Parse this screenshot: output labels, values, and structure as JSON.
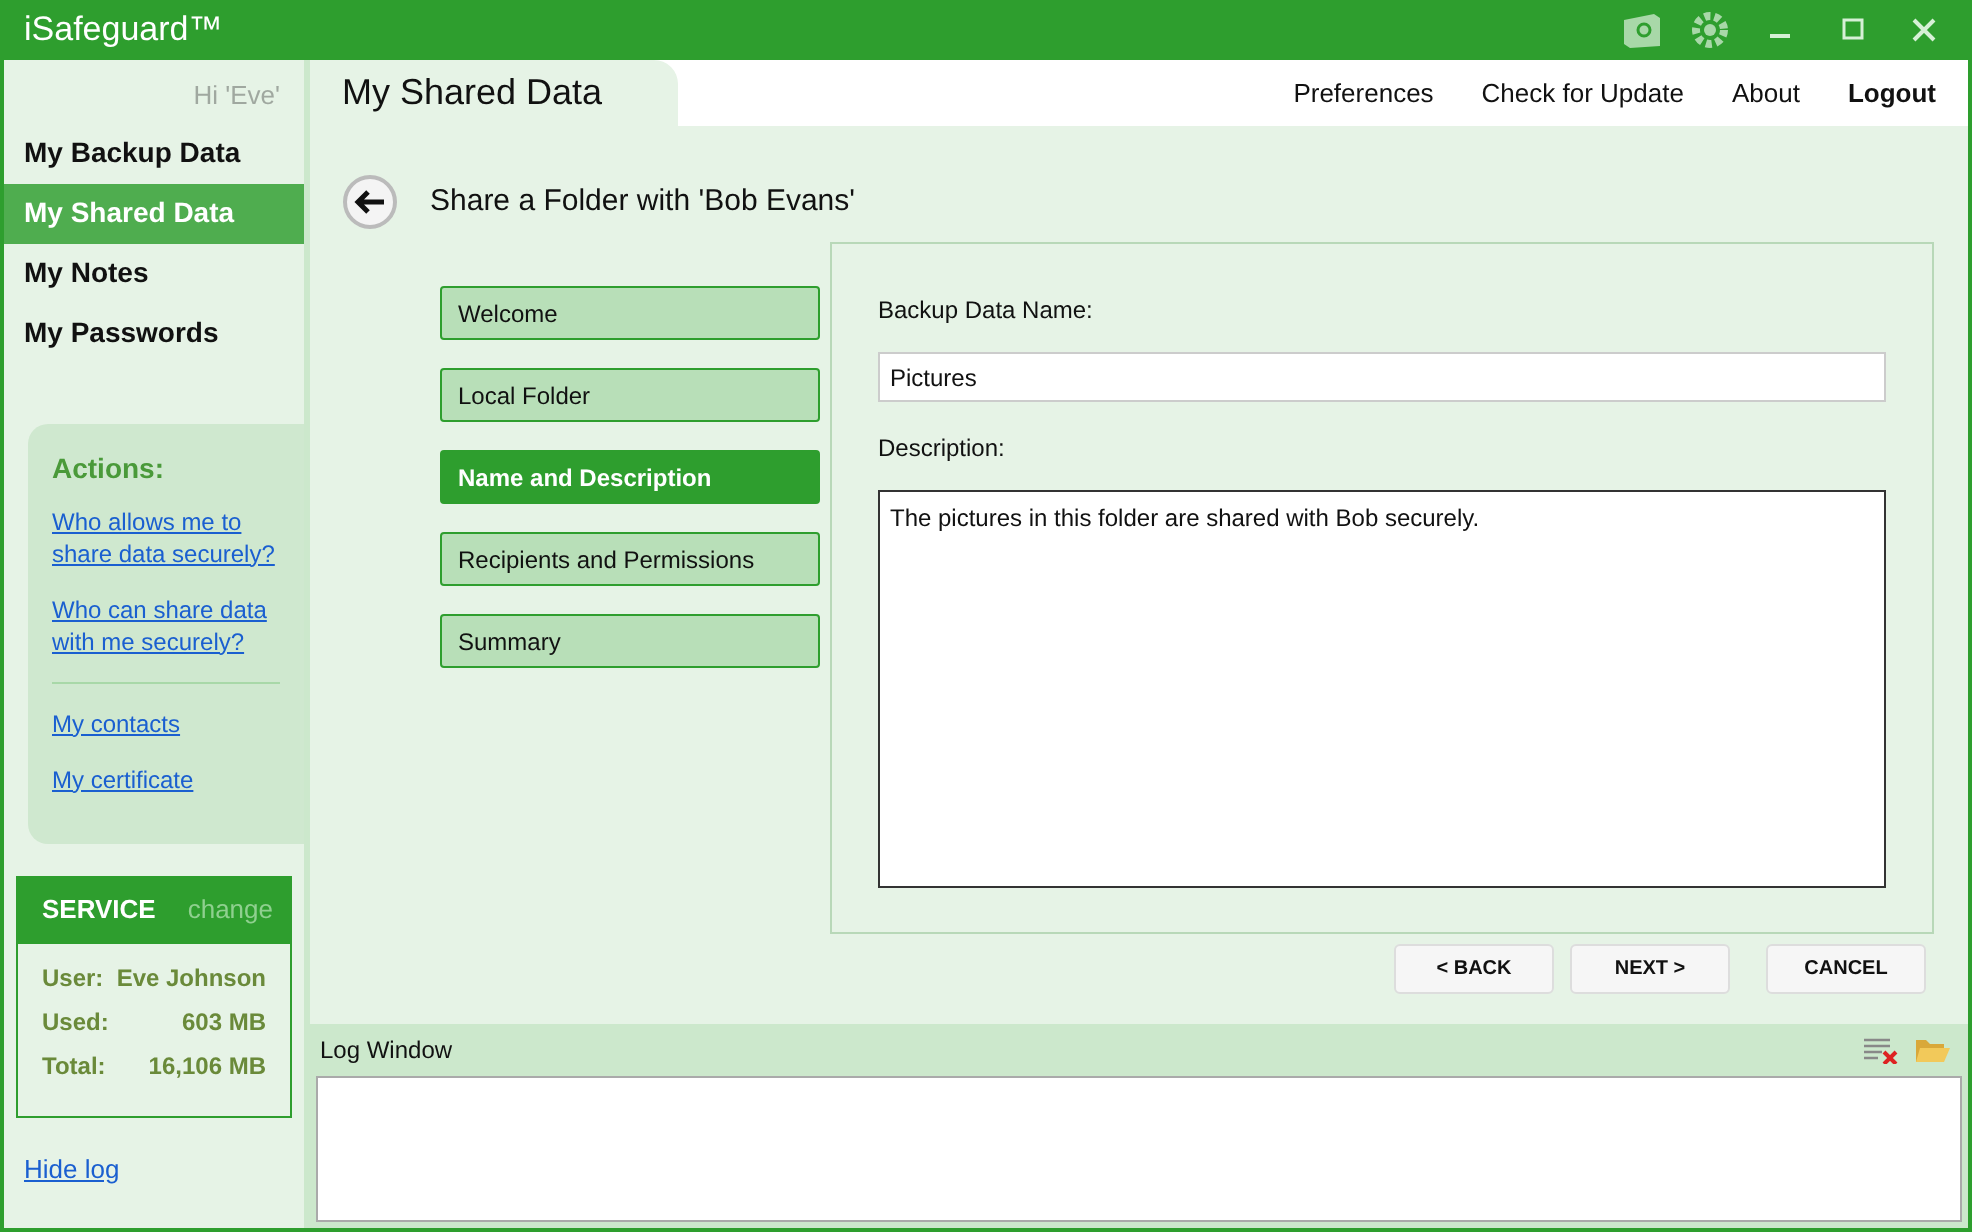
{
  "window": {
    "title": "iSafeguard™"
  },
  "greeting": "Hi 'Eve'",
  "nav": [
    {
      "label": "My Backup Data",
      "selected": false
    },
    {
      "label": "My Shared Data",
      "selected": true
    },
    {
      "label": "My Notes",
      "selected": false
    },
    {
      "label": "My Passwords",
      "selected": false
    }
  ],
  "actions": {
    "title": "Actions:",
    "links": [
      "Who allows me to share data securely?",
      "Who can share data with me securely?"
    ],
    "more_links": [
      "My contacts",
      "My certificate"
    ]
  },
  "service": {
    "title": "SERVICE",
    "change": "change",
    "rows": [
      {
        "label": "User:",
        "value": "Eve Johnson"
      },
      {
        "label": "Used:",
        "value": "603 MB"
      },
      {
        "label": "Total:",
        "value": "16,106 MB"
      }
    ]
  },
  "hide_log": "Hide log",
  "page_tab": "My Shared Data",
  "menu": [
    "Preferences",
    "Check for Update",
    "About",
    "Logout"
  ],
  "heading": "Share a Folder with 'Bob Evans'",
  "steps": [
    {
      "label": "Welcome",
      "selected": false
    },
    {
      "label": "Local Folder",
      "selected": false
    },
    {
      "label": "Name and Description",
      "selected": true
    },
    {
      "label": "Recipients and Permissions",
      "selected": false
    },
    {
      "label": "Summary",
      "selected": false
    }
  ],
  "form": {
    "name_label": "Backup Data Name:",
    "name_value": "Pictures",
    "description_label": "Description:",
    "description_value": "The pictures in this folder are shared with Bob securely."
  },
  "buttons": [
    "< BACK",
    "NEXT >",
    "CANCEL"
  ],
  "log": {
    "title": "Log Window"
  }
}
